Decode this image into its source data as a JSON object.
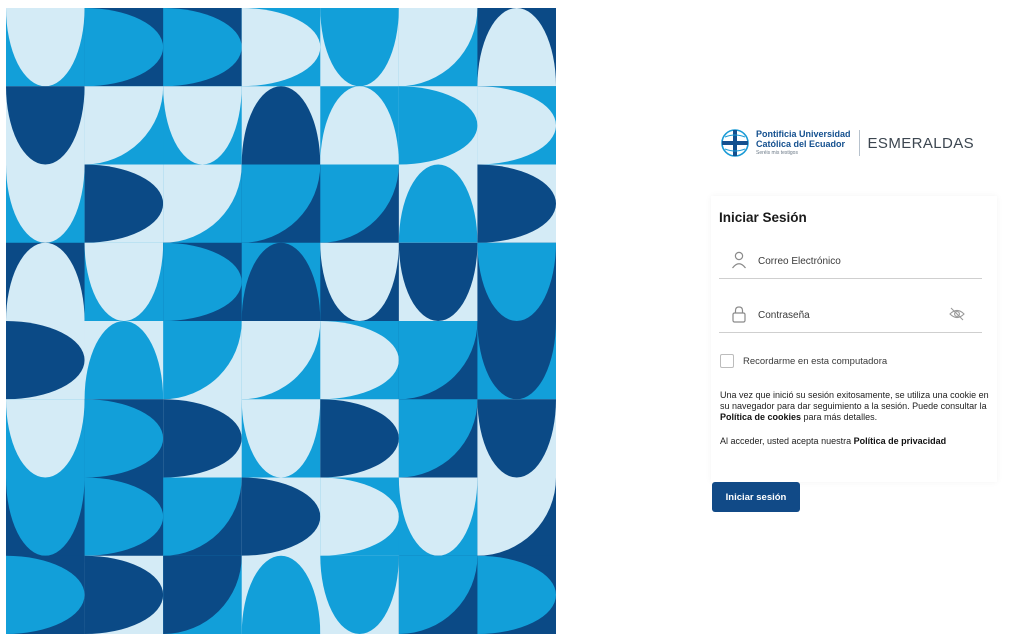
{
  "brand": {
    "university_line1": "Pontificia Universidad",
    "university_line2": "Católica del Ecuador",
    "motto": "Seréis mis testigos",
    "campus": "ESMERALDAS",
    "logo_icon": "cross-crest-icon"
  },
  "login": {
    "title": "Iniciar Sesión",
    "email": {
      "placeholder": "Correo Electrónico",
      "value": "",
      "icon": "user-icon"
    },
    "password": {
      "placeholder": "Contraseña",
      "value": "",
      "icon": "lock-icon",
      "toggle_icon": "eye-off-icon"
    },
    "remember_label": "Recordarme en esta computadora",
    "remember_checked": false,
    "cookie_text_1": "Una vez que inició su sesión exitosamente, se utiliza una cookie en su navegador para dar seguimiento a la sesión. Puede consultar la ",
    "cookie_link": "Política de cookies",
    "cookie_text_2": " para más detalles.",
    "consent_text": "Al acceder, usted acepta nuestra ",
    "privacy_link": "Política de privacidad",
    "submit_label": "Iniciar sesión"
  },
  "colors": {
    "dark_blue": "#0b4a86",
    "mid_blue": "#129fd9",
    "light_blue": "#d4ebf6",
    "button": "#114a87"
  }
}
